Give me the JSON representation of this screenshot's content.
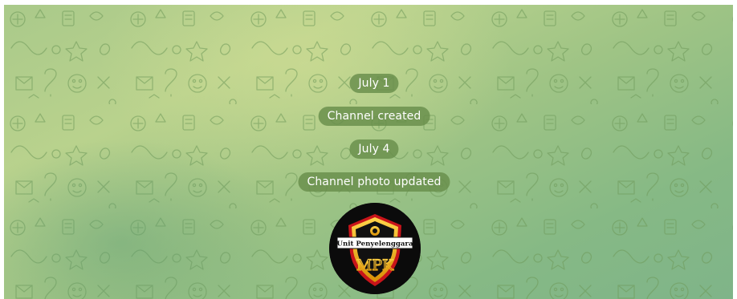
{
  "service_messages": {
    "date_1": "July 1",
    "channel_created": "Channel created",
    "date_2": "July 4",
    "photo_updated": "Channel photo updated"
  },
  "channel_photo": {
    "logo_text": "Unit Penyelenggara",
    "logo_monogram": "MPK"
  },
  "colors": {
    "pill_background": "#688e4a",
    "logo_gold": "#f0b21c",
    "logo_red": "#c8141a"
  }
}
